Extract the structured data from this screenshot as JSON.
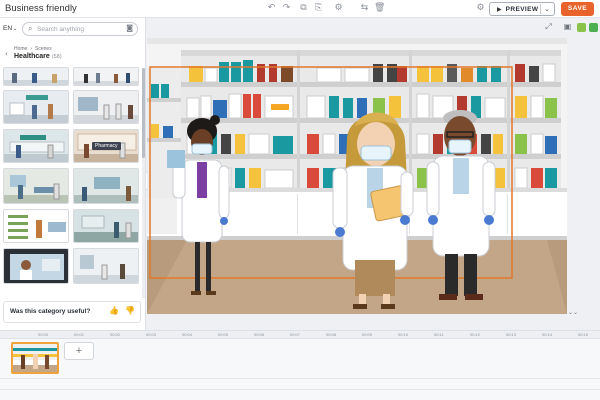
{
  "app": {
    "project_title": "Business friendly"
  },
  "toolbar": {
    "icons": [
      "undo-icon",
      "redo-icon",
      "copy-icon",
      "paste-icon",
      "settings-icon",
      "delete-icon",
      "gear-icon"
    ],
    "preview_label": "PREVIEW",
    "save_label": "SAVE"
  },
  "panel": {
    "language": "EN",
    "search_placeholder": "Search anything",
    "breadcrumb": [
      "Home",
      "Scenes"
    ],
    "category_title": "Healthcare",
    "category_count": "(58)",
    "thumbnails": [
      {
        "name": "thumb-1"
      },
      {
        "name": "thumb-2"
      },
      {
        "name": "thumb-3"
      },
      {
        "name": "thumb-4"
      },
      {
        "name": "thumb-5"
      },
      {
        "name": "thumb-6",
        "label": "Pharmacy"
      },
      {
        "name": "thumb-7"
      },
      {
        "name": "thumb-8"
      },
      {
        "name": "thumb-9"
      },
      {
        "name": "thumb-10"
      },
      {
        "name": "thumb-11"
      },
      {
        "name": "thumb-12"
      }
    ],
    "feedback_question": "Was this category useful?"
  },
  "stage_tools": {
    "colors": [
      "#8bc34a",
      "#4caf50"
    ]
  },
  "timeline": {
    "ticks": [
      "00:00",
      "00:01",
      "00:02",
      "00:03",
      "00:04",
      "00:05",
      "00:06",
      "00:07",
      "00:08",
      "00:09",
      "00:10",
      "00:11",
      "00:12",
      "00:13",
      "00:14",
      "00:15"
    ]
  },
  "colors": {
    "save": "#e8642c",
    "selection": "#f0a33a"
  }
}
